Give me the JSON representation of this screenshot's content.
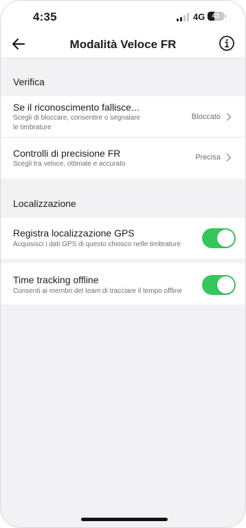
{
  "status_bar": {
    "time": "4:35",
    "network": "4G",
    "battery_percent": "41",
    "battery_level": 0.41,
    "signal_bars_active": 2,
    "signal_bars_total": 4
  },
  "header": {
    "title": "Modalità Veloce FR",
    "back_icon": "arrow-left-icon",
    "info_icon": "info-circle-icon"
  },
  "sections": {
    "verifica": {
      "label": "Verifica",
      "rows": [
        {
          "title": "Se il riconoscimento fallisce...",
          "subtitle_line1": "Scegli di bloccare, consentire o segnalare",
          "subtitle_line2": "le timbrature",
          "value": "Bloccato"
        },
        {
          "title": "Controlli di precisione FR",
          "subtitle_line1": "Scegli tra veloce, ottimale e accurato",
          "value": "Precisa"
        }
      ]
    },
    "localizzazione": {
      "label": "Localizzazione",
      "rows": [
        {
          "title": "Registra localizzazione GPS",
          "subtitle_line1": "Acquisisci i dati GPS di questo chiosco nelle timbrature",
          "enabled": true
        },
        {
          "title": "Time tracking offline",
          "subtitle_line1": "Consenti ai membri del team di tracciare il tempo offline",
          "enabled": true
        }
      ]
    }
  },
  "colors": {
    "toggle_on": "#34c759",
    "background": "#f2f2f4",
    "text_primary": "#1c1c1e",
    "text_secondary": "#6e6e73"
  }
}
